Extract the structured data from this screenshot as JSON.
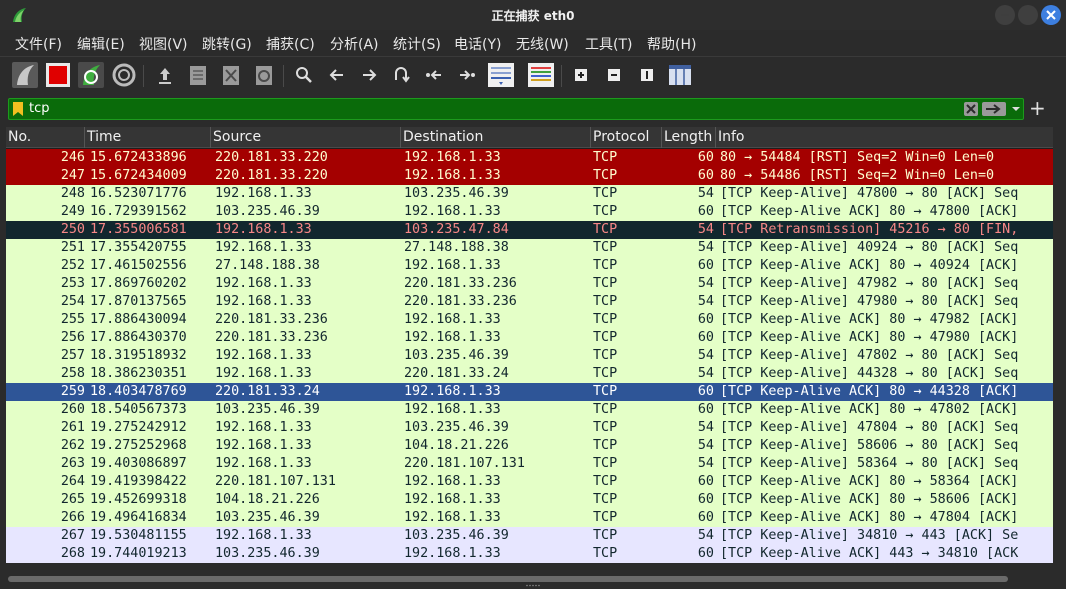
{
  "window": {
    "title": "正在捕获 eth0",
    "app_icon": "wireshark-fin-icon",
    "controls": [
      "minimize-icon",
      "maximize-icon",
      "close-icon"
    ],
    "accent": "#3d7fe0"
  },
  "menu": [
    "文件(F)",
    "编辑(E)",
    "视图(V)",
    "跳转(G)",
    "捕获(C)",
    "分析(A)",
    "统计(S)",
    "电话(Y)",
    "无线(W)",
    "工具(T)",
    "帮助(H)"
  ],
  "toolbar_icons": [
    "start-capture-icon",
    "stop-capture-icon",
    "restart-capture-icon",
    "capture-options-icon",
    "open-file-icon",
    "save-file-icon",
    "close-file-icon",
    "reload-file-icon",
    "find-packet-icon",
    "go-back-icon",
    "go-forward-icon",
    "go-to-packet-icon",
    "first-packet-icon",
    "last-packet-icon",
    "auto-scroll-icon",
    "colorize-icon",
    "zoom-in-icon",
    "zoom-out-icon",
    "normal-size-icon",
    "resize-columns-icon"
  ],
  "filter": {
    "value": "tcp",
    "bg_color": "#0a6b0a"
  },
  "columns": [
    "No.",
    "Time",
    "Source",
    "Destination",
    "Protocol",
    "Length",
    "Info"
  ],
  "row_colors": {
    "rst": "#a40000",
    "keepalive": "#e4ffc7",
    "retransmission": "#12272e",
    "selected": "#2e5597",
    "lavender": "#e7e6ff"
  },
  "packets": [
    {
      "no": "246",
      "time": "15.672433896",
      "src": "220.181.33.220",
      "dst": "192.168.1.33",
      "proto": "TCP",
      "len": "60",
      "info": "80 → 54484 [RST] Seq=2 Win=0 Len=0",
      "style": "rst"
    },
    {
      "no": "247",
      "time": "15.672434009",
      "src": "220.181.33.220",
      "dst": "192.168.1.33",
      "proto": "TCP",
      "len": "60",
      "info": "80 → 54486 [RST] Seq=2 Win=0 Len=0",
      "style": "rst"
    },
    {
      "no": "248",
      "time": "16.523071776",
      "src": "192.168.1.33",
      "dst": "103.235.46.39",
      "proto": "TCP",
      "len": "54",
      "info": "[TCP Keep-Alive] 47800 → 80 [ACK] Seq",
      "style": "ka"
    },
    {
      "no": "249",
      "time": "16.729391562",
      "src": "103.235.46.39",
      "dst": "192.168.1.33",
      "proto": "TCP",
      "len": "60",
      "info": "[TCP Keep-Alive ACK] 80 → 47800 [ACK]",
      "style": "ka"
    },
    {
      "no": "250",
      "time": "17.355006581",
      "src": "192.168.1.33",
      "dst": "103.235.47.84",
      "proto": "TCP",
      "len": "54",
      "info": "[TCP Retransmission] 45216 → 80 [FIN,",
      "style": "retx"
    },
    {
      "no": "251",
      "time": "17.355420755",
      "src": "192.168.1.33",
      "dst": "27.148.188.38",
      "proto": "TCP",
      "len": "54",
      "info": "[TCP Keep-Alive] 40924 → 80 [ACK] Seq",
      "style": "ka"
    },
    {
      "no": "252",
      "time": "17.461502556",
      "src": "27.148.188.38",
      "dst": "192.168.1.33",
      "proto": "TCP",
      "len": "60",
      "info": "[TCP Keep-Alive ACK] 80 → 40924 [ACK]",
      "style": "ka"
    },
    {
      "no": "253",
      "time": "17.869760202",
      "src": "192.168.1.33",
      "dst": "220.181.33.236",
      "proto": "TCP",
      "len": "54",
      "info": "[TCP Keep-Alive] 47982 → 80 [ACK] Seq",
      "style": "ka"
    },
    {
      "no": "254",
      "time": "17.870137565",
      "src": "192.168.1.33",
      "dst": "220.181.33.236",
      "proto": "TCP",
      "len": "54",
      "info": "[TCP Keep-Alive] 47980 → 80 [ACK] Seq",
      "style": "ka"
    },
    {
      "no": "255",
      "time": "17.886430094",
      "src": "220.181.33.236",
      "dst": "192.168.1.33",
      "proto": "TCP",
      "len": "60",
      "info": "[TCP Keep-Alive ACK] 80 → 47982 [ACK]",
      "style": "ka"
    },
    {
      "no": "256",
      "time": "17.886430370",
      "src": "220.181.33.236",
      "dst": "192.168.1.33",
      "proto": "TCP",
      "len": "60",
      "info": "[TCP Keep-Alive ACK] 80 → 47980 [ACK]",
      "style": "ka"
    },
    {
      "no": "257",
      "time": "18.319518932",
      "src": "192.168.1.33",
      "dst": "103.235.46.39",
      "proto": "TCP",
      "len": "54",
      "info": "[TCP Keep-Alive] 47802 → 80 [ACK] Seq",
      "style": "ka"
    },
    {
      "no": "258",
      "time": "18.386230351",
      "src": "192.168.1.33",
      "dst": "220.181.33.24",
      "proto": "TCP",
      "len": "54",
      "info": "[TCP Keep-Alive] 44328 → 80 [ACK] Seq",
      "style": "ka"
    },
    {
      "no": "259",
      "time": "18.403478769",
      "src": "220.181.33.24",
      "dst": "192.168.1.33",
      "proto": "TCP",
      "len": "60",
      "info": "[TCP Keep-Alive ACK] 80 → 44328 [ACK]",
      "style": "selected"
    },
    {
      "no": "260",
      "time": "18.540567373",
      "src": "103.235.46.39",
      "dst": "192.168.1.33",
      "proto": "TCP",
      "len": "60",
      "info": "[TCP Keep-Alive ACK] 80 → 47802 [ACK]",
      "style": "ka"
    },
    {
      "no": "261",
      "time": "19.275242912",
      "src": "192.168.1.33",
      "dst": "103.235.46.39",
      "proto": "TCP",
      "len": "54",
      "info": "[TCP Keep-Alive] 47804 → 80 [ACK] Seq",
      "style": "ka"
    },
    {
      "no": "262",
      "time": "19.275252968",
      "src": "192.168.1.33",
      "dst": "104.18.21.226",
      "proto": "TCP",
      "len": "54",
      "info": "[TCP Keep-Alive] 58606 → 80 [ACK] Seq",
      "style": "ka"
    },
    {
      "no": "263",
      "time": "19.403086897",
      "src": "192.168.1.33",
      "dst": "220.181.107.131",
      "proto": "TCP",
      "len": "54",
      "info": "[TCP Keep-Alive] 58364 → 80 [ACK] Seq",
      "style": "ka"
    },
    {
      "no": "264",
      "time": "19.419398422",
      "src": "220.181.107.131",
      "dst": "192.168.1.33",
      "proto": "TCP",
      "len": "60",
      "info": "[TCP Keep-Alive ACK] 80 → 58364 [ACK]",
      "style": "ka"
    },
    {
      "no": "265",
      "time": "19.452699318",
      "src": "104.18.21.226",
      "dst": "192.168.1.33",
      "proto": "TCP",
      "len": "60",
      "info": "[TCP Keep-Alive ACK] 80 → 58606 [ACK]",
      "style": "ka"
    },
    {
      "no": "266",
      "time": "19.496416834",
      "src": "103.235.46.39",
      "dst": "192.168.1.33",
      "proto": "TCP",
      "len": "60",
      "info": "[TCP Keep-Alive ACK] 80 → 47804 [ACK]",
      "style": "ka"
    },
    {
      "no": "267",
      "time": "19.530481155",
      "src": "192.168.1.33",
      "dst": "103.235.46.39",
      "proto": "TCP",
      "len": "54",
      "info": "[TCP Keep-Alive] 34810 → 443 [ACK] Se",
      "style": "lavender"
    },
    {
      "no": "268",
      "time": "19.744019213",
      "src": "103.235.46.39",
      "dst": "192.168.1.33",
      "proto": "TCP",
      "len": "60",
      "info": "[TCP Keep-Alive ACK] 443 → 34810 [ACK",
      "style": "lavender"
    }
  ]
}
